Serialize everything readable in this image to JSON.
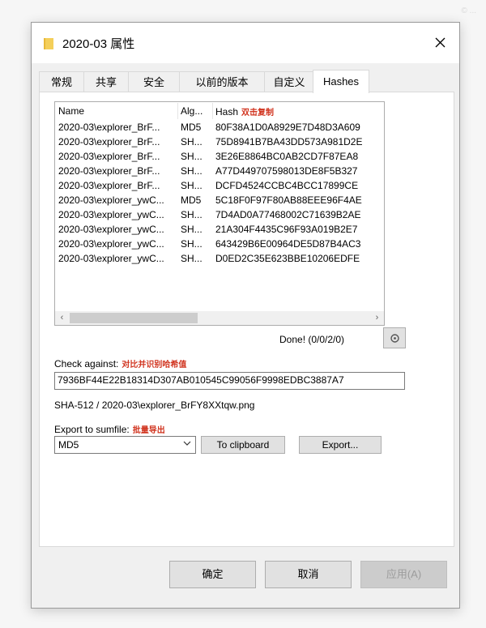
{
  "window": {
    "title": "2020-03 属性"
  },
  "tabs": [
    {
      "label": "常规"
    },
    {
      "label": "共享"
    },
    {
      "label": "安全"
    },
    {
      "label": "以前的版本"
    },
    {
      "label": "自定义"
    },
    {
      "label": "Hashes",
      "active": true
    }
  ],
  "list": {
    "columns": {
      "name": "Name",
      "algorithm": "Alg...",
      "hash": "Hash",
      "hash_annotation": "双击复制"
    },
    "rows": [
      {
        "name": "2020-03\\explorer_BrF...",
        "alg": "MD5",
        "hash": "80F38A1D0A8929E7D48D3A609"
      },
      {
        "name": "2020-03\\explorer_BrF...",
        "alg": "SH...",
        "hash": "75D8941B7BA43DD573A981D2E"
      },
      {
        "name": "2020-03\\explorer_BrF...",
        "alg": "SH...",
        "hash": "3E26E8864BC0AB2CD7F87EA8"
      },
      {
        "name": "2020-03\\explorer_BrF...",
        "alg": "SH...",
        "hash": "A77D449707598013DE8F5B327"
      },
      {
        "name": "2020-03\\explorer_BrF...",
        "alg": "SH...",
        "hash": "DCFD4524CCBC4BCC17899CE"
      },
      {
        "name": "2020-03\\explorer_ywC...",
        "alg": "MD5",
        "hash": "5C18F0F97F80AB88EEE96F4AE"
      },
      {
        "name": "2020-03\\explorer_ywC...",
        "alg": "SH...",
        "hash": "7D4AD0A77468002C71639B2AE"
      },
      {
        "name": "2020-03\\explorer_ywC...",
        "alg": "SH...",
        "hash": "21A304F4435C96F93A019B2E7"
      },
      {
        "name": "2020-03\\explorer_ywC...",
        "alg": "SH...",
        "hash": "643429B6E00964DE5D87B4AC3"
      },
      {
        "name": "2020-03\\explorer_ywC...",
        "alg": "SH...",
        "hash": "D0ED2C35E623BBE10206EDFE"
      }
    ]
  },
  "status": {
    "text": "Done! (0/0/2/0)"
  },
  "check": {
    "label": "Check against:",
    "annotation": "对比并识别哈希值",
    "value": "7936BF44E22B18314D307AB010545C99056F9998EDBC3887A7",
    "match_result": "SHA-512 / 2020-03\\explorer_BrFY8XXtqw.png"
  },
  "export": {
    "label": "Export to sumfile:",
    "annotation": "批量导出",
    "selected": "MD5",
    "clipboard_label": "To clipboard",
    "export_label": "Export..."
  },
  "footer": {
    "ok_label": "确定",
    "cancel_label": "取消",
    "apply_label": "应用(A)"
  },
  "watermark": "© ..."
}
